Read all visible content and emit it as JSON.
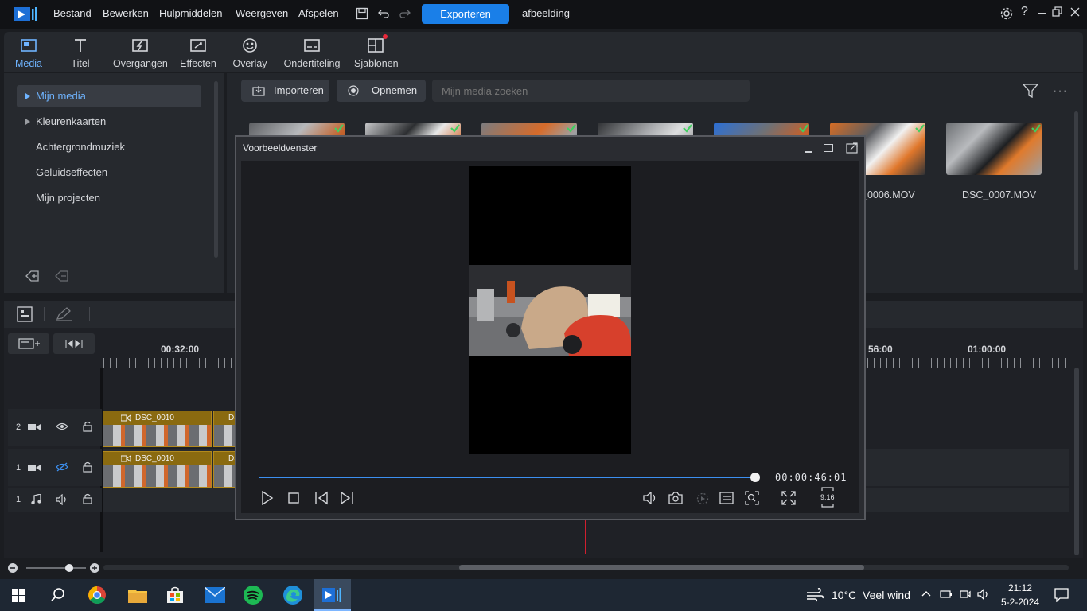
{
  "titlebar": {
    "menu": [
      "Bestand",
      "Bewerken",
      "Hulpmiddelen",
      "Weergeven",
      "Afspelen"
    ],
    "export_label": "Exporteren",
    "project_name": "afbeelding"
  },
  "toolbar": {
    "tabs": [
      {
        "label": "Media",
        "icon": "media-icon",
        "active": true
      },
      {
        "label": "Titel",
        "icon": "title-icon"
      },
      {
        "label": "Overgangen",
        "icon": "transition-icon"
      },
      {
        "label": "Effecten",
        "icon": "effects-icon"
      },
      {
        "label": "Overlay",
        "icon": "overlay-icon"
      },
      {
        "label": "Ondertiteling",
        "icon": "subtitle-icon"
      },
      {
        "label": "Sjablonen",
        "icon": "template-icon"
      }
    ]
  },
  "sidebar": {
    "items": [
      "Mijn media",
      "Kleurenkaarten",
      "Achtergrondmuziek",
      "Geluidseffecten",
      "Mijn projecten"
    ]
  },
  "media": {
    "import_label": "Importeren",
    "record_label": "Opnemen",
    "search_placeholder": "Mijn media zoeken",
    "files": [
      "_0006.MOV",
      "DSC_0007.MOV"
    ]
  },
  "timeline": {
    "ruler": [
      "00:32:00",
      "56:00",
      "01:00:00"
    ],
    "tracks": [
      {
        "number": "2",
        "clips": [
          "DSC_0010",
          "DS"
        ]
      },
      {
        "number": "1",
        "clips": [
          "DSC_0010",
          "DS"
        ]
      },
      {
        "number": "1"
      }
    ]
  },
  "preview": {
    "title": "Voorbeeldvenster",
    "timecode": "00:00:46:01",
    "aspect": "9:16",
    "progress": 1.0
  },
  "taskbar": {
    "weather": "10°C  Veel wind",
    "time": "21:12",
    "date": "5-2-2024"
  },
  "colors": {
    "accent": "#1a7fe8",
    "link": "#6fb4ff",
    "playhead": "#d01f2f"
  }
}
